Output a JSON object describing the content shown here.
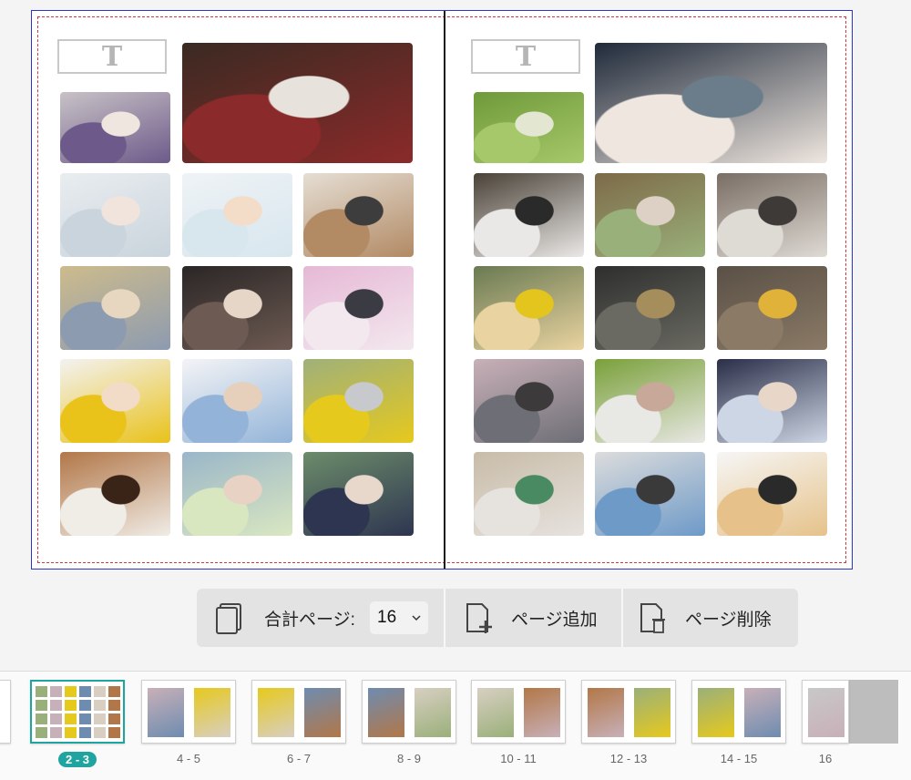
{
  "spread": {
    "left_page": {
      "title_placeholder": "T",
      "photos": [
        {
          "name": "baby-sitting-purple-cushion",
          "colors": [
            "#c8c2c6",
            "#6d5a8a",
            "#f0e6e0"
          ]
        },
        {
          "name": "baby-hina-dolls",
          "colors": [
            "#3a2a22",
            "#8b2a2a",
            "#e8e2dc"
          ]
        },
        {
          "name": "baby-lying-pillow",
          "colors": [
            "#e9edf0",
            "#c9d4dc",
            "#f1e4dc"
          ]
        },
        {
          "name": "baby-pale-blue-bg",
          "colors": [
            "#eef3f6",
            "#d8e6ee",
            "#f3dcc8"
          ]
        },
        {
          "name": "mother-baby-room",
          "colors": [
            "#e5ded4",
            "#b28a64",
            "#3d3d3d"
          ]
        },
        {
          "name": "baby-stuffed-toy",
          "colors": [
            "#cdbb8c",
            "#8d9bb0",
            "#e8d7c0"
          ]
        },
        {
          "name": "mother-dark-coat",
          "colors": [
            "#2a2626",
            "#6d5a52",
            "#e6d6c8"
          ]
        },
        {
          "name": "baby-pink-hat",
          "colors": [
            "#e6b8d6",
            "#f3e8ee",
            "#3b3b44"
          ]
        },
        {
          "name": "baby-yellow-shirt",
          "colors": [
            "#f3f2f2",
            "#e9c21a",
            "#f2dcc8"
          ]
        },
        {
          "name": "father-baby-white",
          "colors": [
            "#f4f4f6",
            "#93b4d8",
            "#e6d0bc"
          ]
        },
        {
          "name": "mother-baby-grass",
          "colors": [
            "#9fb07a",
            "#e6c91d",
            "#c7c9cc"
          ]
        },
        {
          "name": "baby-held-up",
          "colors": [
            "#b27748",
            "#f0ece6",
            "#3a2418"
          ]
        },
        {
          "name": "baby-flower-field",
          "colors": [
            "#9ab6c9",
            "#d9e7c1",
            "#e8d2c4"
          ]
        },
        {
          "name": "baby-navy-hat",
          "colors": [
            "#6c8c6a",
            "#2e3550",
            "#e8d8cc"
          ]
        }
      ]
    },
    "right_page": {
      "title_placeholder": "T",
      "photos": [
        {
          "name": "baby-bottle",
          "colors": [
            "#1f2a3a",
            "#efe6df",
            "#6b7d8a"
          ]
        },
        {
          "name": "baby-on-lawn",
          "colors": [
            "#6f9a3a",
            "#a6c86a",
            "#e3e6d0"
          ]
        },
        {
          "name": "family-balcony",
          "colors": [
            "#4a4238",
            "#eae8e6",
            "#2a2a2a"
          ]
        },
        {
          "name": "zoo-elephant",
          "colors": [
            "#7d6a48",
            "#9ab07a",
            "#ddd0c4"
          ]
        },
        {
          "name": "mother-baby-phone",
          "colors": [
            "#7a6e64",
            "#dedad4",
            "#3e3a38"
          ]
        },
        {
          "name": "toddler-park-walk",
          "colors": [
            "#6a7a52",
            "#e9d3a0",
            "#e3c51d"
          ]
        },
        {
          "name": "man-child-path",
          "colors": [
            "#2e2e2e",
            "#6a6a62",
            "#a58d5c"
          ]
        },
        {
          "name": "toddler-gravel",
          "colors": [
            "#5a5046",
            "#8a7a66",
            "#e0b23a"
          ]
        },
        {
          "name": "cherry-blossom-family",
          "colors": [
            "#c8b0b8",
            "#6e6e76",
            "#3c3a3a"
          ]
        },
        {
          "name": "woman-green-park",
          "colors": [
            "#7aa03a",
            "#e8e8e4",
            "#c8a898"
          ]
        },
        {
          "name": "father-child-cap",
          "colors": [
            "#2a2e48",
            "#cdd6e4",
            "#e8d6c8"
          ]
        },
        {
          "name": "baby-toy-walker",
          "colors": [
            "#c8bca8",
            "#e6e2de",
            "#4a8a62"
          ]
        },
        {
          "name": "birthday-banner",
          "colors": [
            "#dcdcdc",
            "#6e9ac8",
            "#3a3a3a"
          ]
        },
        {
          "name": "child-lifted-sky",
          "colors": [
            "#f6f6f6",
            "#e6c28a",
            "#2a2a2a"
          ]
        }
      ]
    }
  },
  "toolbar": {
    "total_pages_label": "合計ページ:",
    "total_pages_value": "16",
    "add_page_label": "ページ追加",
    "delete_page_label": "ページ削除"
  },
  "thumbnails": [
    {
      "label": "2 - 3",
      "active": true
    },
    {
      "label": "4 - 5",
      "active": false
    },
    {
      "label": "6 - 7",
      "active": false
    },
    {
      "label": "8 - 9",
      "active": false
    },
    {
      "label": "10 - 11",
      "active": false
    },
    {
      "label": "12 - 13",
      "active": false
    },
    {
      "label": "14 - 15",
      "active": false
    },
    {
      "label": "16",
      "active": false
    }
  ],
  "colors": {
    "accent": "#1fa4a0",
    "spread_border": "#2a35c8",
    "bleed_line": "#d23a3a"
  }
}
